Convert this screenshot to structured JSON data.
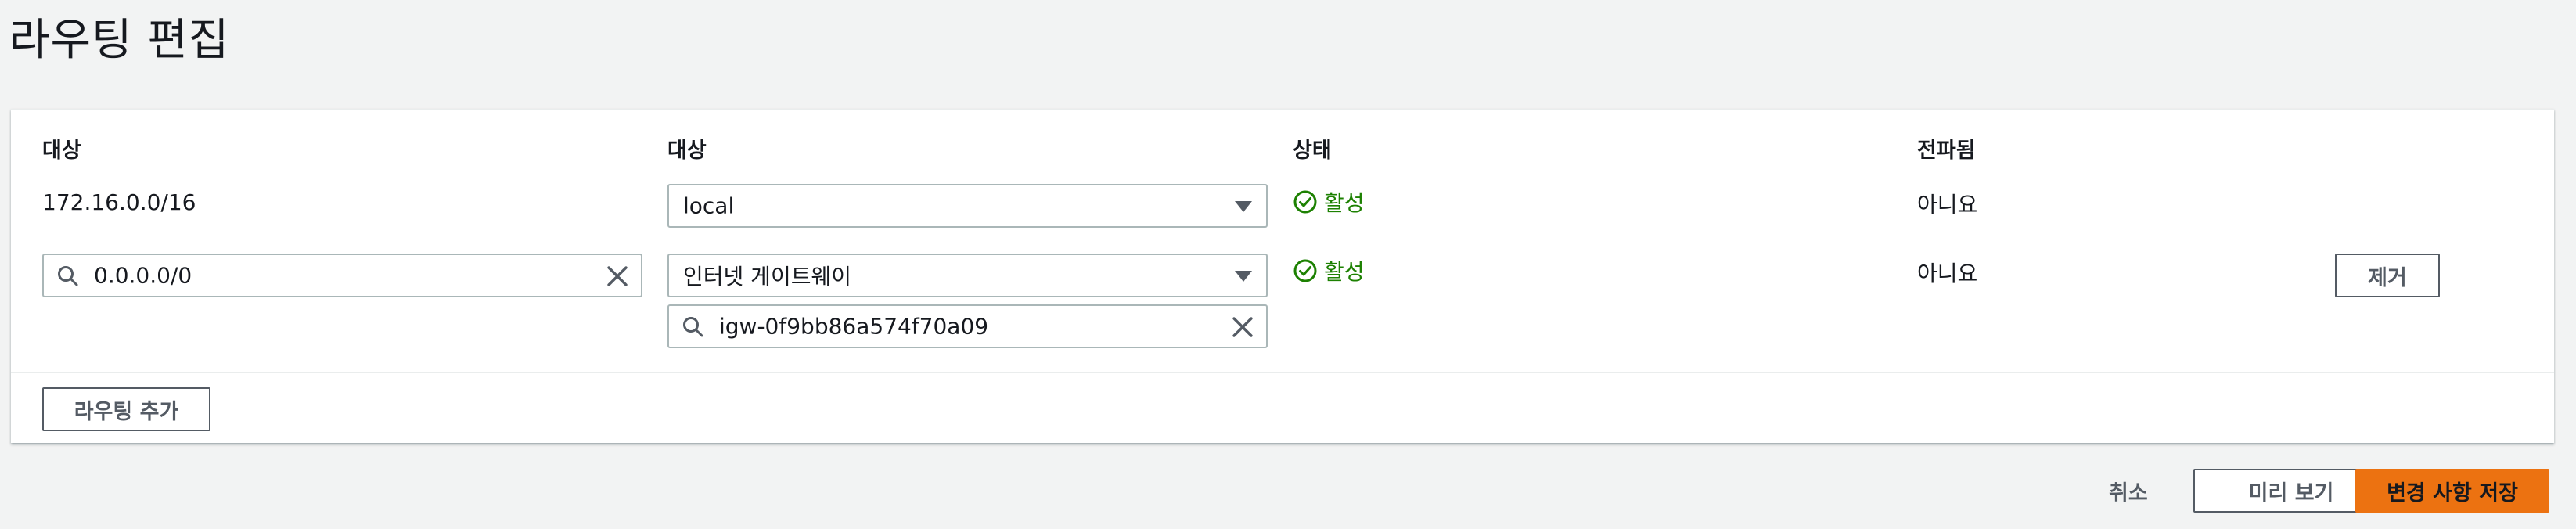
{
  "page": {
    "title": "라우팅 편집"
  },
  "columns": {
    "destination": "대상",
    "target": "대상",
    "status": "상태",
    "propagated": "전파됨"
  },
  "routes": [
    {
      "destination": "172.16.0.0/16",
      "target": "local",
      "status": "활성",
      "propagated": "아니요"
    },
    {
      "destination": "0.0.0.0/0",
      "target": "인터넷 게이트웨이",
      "target_id": "igw-0f9bb86a574f70a09",
      "status": "활성",
      "propagated": "아니요",
      "remove_label": "제거"
    }
  ],
  "add_route_label": "라우팅 추가",
  "footer": {
    "cancel": "취소",
    "preview": "미리 보기",
    "save": "변경 사항 저장"
  },
  "colors": {
    "primary": "#ec7211",
    "success": "#1d8102",
    "border": "#aab7b8",
    "background": "#f2f3f3"
  },
  "icons": [
    "search-icon",
    "clear-icon",
    "dropdown-caret-icon",
    "status-ok-icon"
  ]
}
